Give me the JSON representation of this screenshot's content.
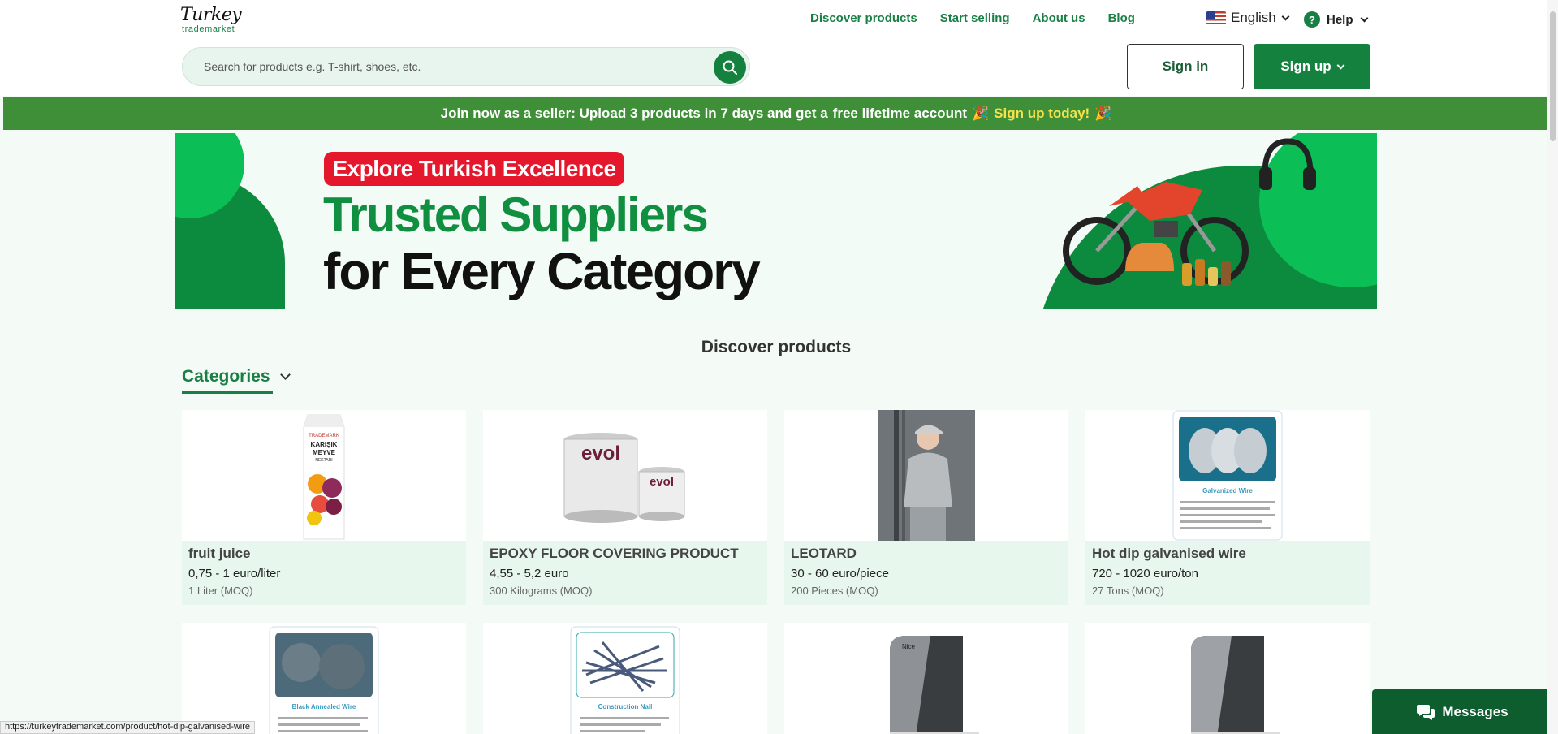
{
  "header": {
    "logo": {
      "line1": "Turkey",
      "line2": "trademarket"
    },
    "nav": [
      "Discover products",
      "Start selling",
      "About us",
      "Blog"
    ],
    "language": "English",
    "help": "Help",
    "search_placeholder": "Search for products e.g. T-shirt, shoes, etc.",
    "signin": "Sign in",
    "signup": "Sign up"
  },
  "announcement": {
    "prefix": "Join now as a seller: Upload 3 products in 7 days and get a",
    "link": "free lifetime account",
    "cta": "Sign up today!",
    "emoji": "🎉"
  },
  "banner": {
    "badge": "Explore Turkish Excellence",
    "line1": "Trusted Suppliers",
    "line2": "for Every Category"
  },
  "section_title": "Discover products",
  "categories_label": "Categories",
  "products": [
    {
      "name": "fruit juice",
      "price": "0,75 - 1 euro/liter",
      "moq": "1 Liter (MOQ)"
    },
    {
      "name": "EPOXY FLOOR COVERING PRODUCT",
      "price": "4,55 - 5,2 euro",
      "moq": "300 Kilograms (MOQ)"
    },
    {
      "name": "LEOTARD",
      "price": "30 - 60 euro/piece",
      "moq": "200 Pieces (MOQ)"
    },
    {
      "name": "Hot dip galvanised wire",
      "price": "720 - 1020 euro/ton",
      "moq": "27 Tons (MOQ)"
    }
  ],
  "product_images": {
    "juice": {
      "brand": "TRADEMARK",
      "line1": "KARIŞIK",
      "line2": "MEYVE",
      "line3": "NEKTARI"
    },
    "paint": {
      "brand": "evol"
    },
    "wire": {
      "title": "Galvanized Wire"
    },
    "annealed": {
      "title": "Black Annealed Wire"
    },
    "nail": {
      "title": "Construction Nail"
    },
    "motor": {
      "brand": "Nice"
    }
  },
  "status_url": "https://turkeytrademarket.com/product/hot-dip-galvanised-wire",
  "messages": "Messages",
  "colors": {
    "brand_green": "#14813f",
    "announce_green": "#3e8f37",
    "badge_red": "#e5172d",
    "card_info": "#e8f7ee"
  }
}
